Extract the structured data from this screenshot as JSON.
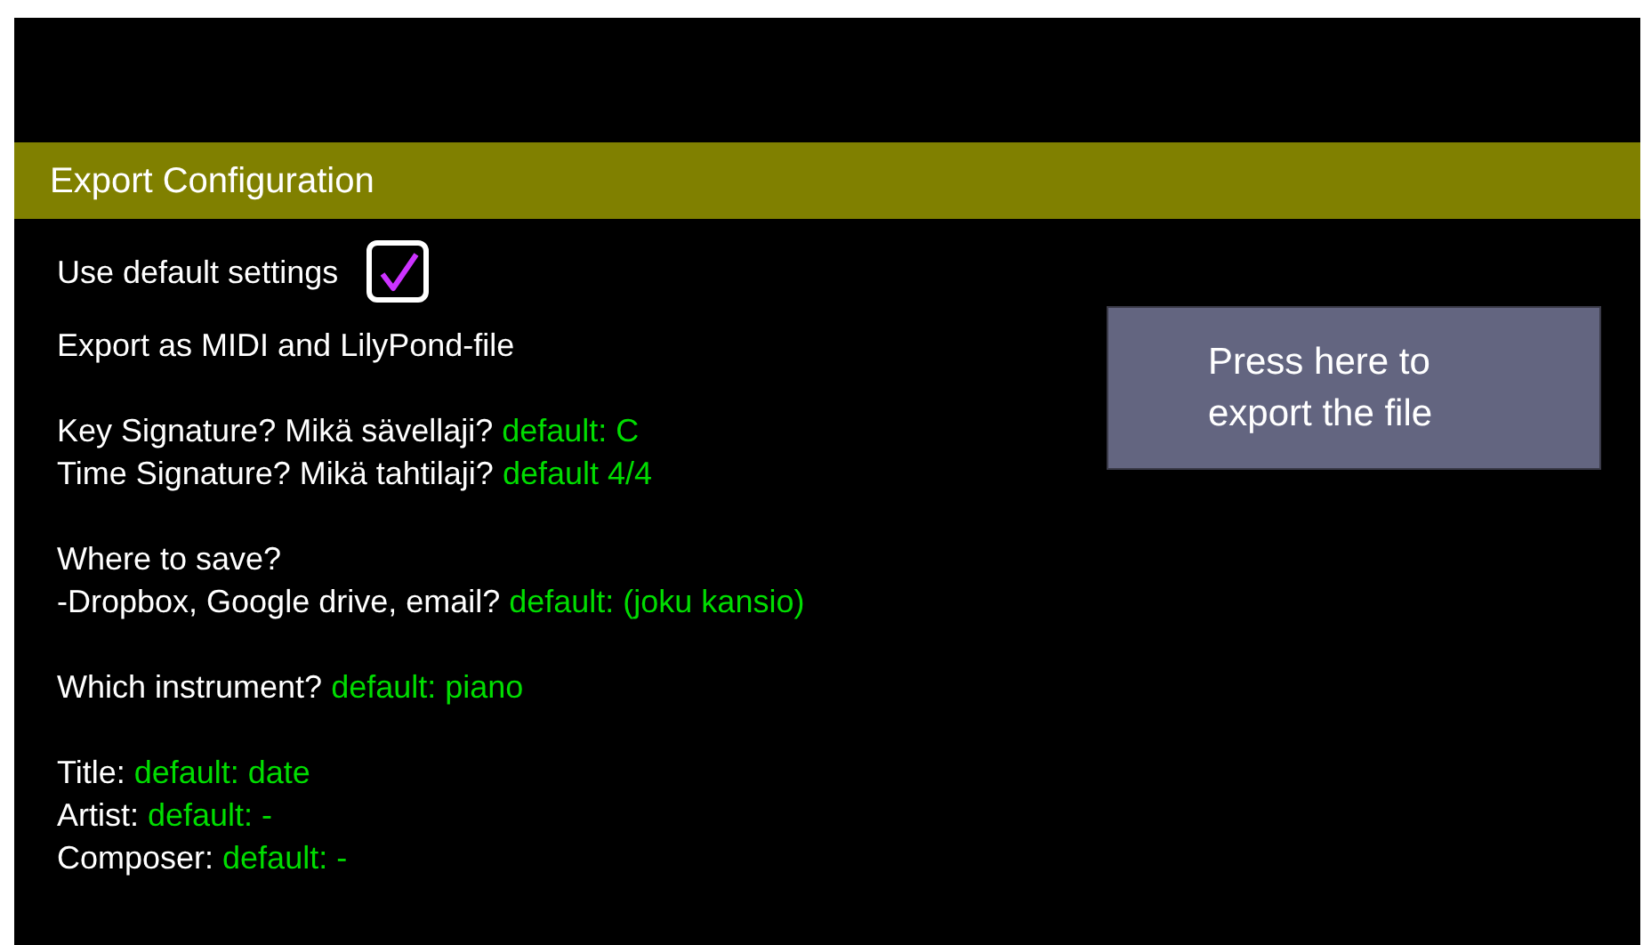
{
  "header": {
    "title": "Export Configuration"
  },
  "default_settings": {
    "label": "Use default settings",
    "checked": true
  },
  "groups": [
    [
      {
        "label": "Export as MIDI and LilyPond-file"
      }
    ],
    [
      {
        "label": "Key Signature? Mikä sävellaji?",
        "value": "default: C"
      },
      {
        "label": "Time Signature? Mikä tahtilaji?",
        "value": "default 4/4"
      }
    ],
    [
      {
        "label": "Where to save?"
      },
      {
        "label": "-Dropbox, Google drive, email?",
        "value": "default: (joku kansio)"
      }
    ],
    [
      {
        "label": "Which instrument?",
        "value": "default: piano"
      }
    ],
    [
      {
        "label": "Title:",
        "value": "default: date"
      },
      {
        "label": "Artist:",
        "value": "default: -"
      },
      {
        "label": "Composer:",
        "value": "default: -"
      }
    ]
  ],
  "export_button": {
    "label": "Press here to export the file"
  }
}
